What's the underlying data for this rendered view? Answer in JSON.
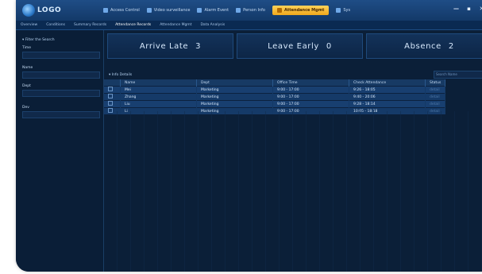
{
  "app": {
    "logo_text": "LOGO"
  },
  "topmenu": [
    {
      "label": "Access Control",
      "icon": "access-icon",
      "active": false
    },
    {
      "label": "Video surveillance",
      "icon": "camera-icon",
      "active": false
    },
    {
      "label": "Alarm Event",
      "icon": "alarm-icon",
      "active": false
    },
    {
      "label": "Person Info",
      "icon": "person-icon",
      "active": false
    },
    {
      "label": "Attendance Mgmt",
      "icon": "attendance-icon",
      "active": true
    },
    {
      "label": "Sys",
      "icon": "system-icon",
      "active": false
    }
  ],
  "window_controls": {
    "minimize": "—",
    "maximize": "▪",
    "close": "✕"
  },
  "subtabs": [
    "Overview",
    "Conditions",
    "Summary Records",
    "Attendance Records",
    "Attendance Mgmt",
    "Data Analysis"
  ],
  "sidebar": {
    "top_mark": "",
    "header": "▾ Filter the Search",
    "fields": [
      {
        "label": "Time"
      },
      {
        "label": "Name"
      },
      {
        "label": "Dept"
      },
      {
        "label": "Dev"
      }
    ]
  },
  "stats": [
    {
      "label": "Arrive Late",
      "value": "3"
    },
    {
      "label": "Leave Early",
      "value": "0"
    },
    {
      "label": "Absence",
      "value": "2"
    }
  ],
  "details": {
    "label": "▾ Info Details",
    "search_placeholder": "Search Name"
  },
  "table": {
    "columns": [
      "",
      "Name",
      "Dept",
      "Office Time",
      "Check Attendance",
      "Status"
    ],
    "rows": [
      {
        "name": "Mei",
        "dept": "Marketing",
        "office_time": "9:00 - 17:00",
        "check": "9:26 - 18:05",
        "status": "detail"
      },
      {
        "name": "Zhang",
        "dept": "Marketing",
        "office_time": "9:00 - 17:00",
        "check": "9:40 - 20:06",
        "status": "detail"
      },
      {
        "name": "Liu",
        "dept": "Marketing",
        "office_time": "9:00 - 17:00",
        "check": "9:28 - 18:14",
        "status": "detail"
      },
      {
        "name": "Li",
        "dept": "Marketing",
        "office_time": "9:00 - 17:00",
        "check": "10:05 - 18:18",
        "status": "detail"
      }
    ]
  }
}
